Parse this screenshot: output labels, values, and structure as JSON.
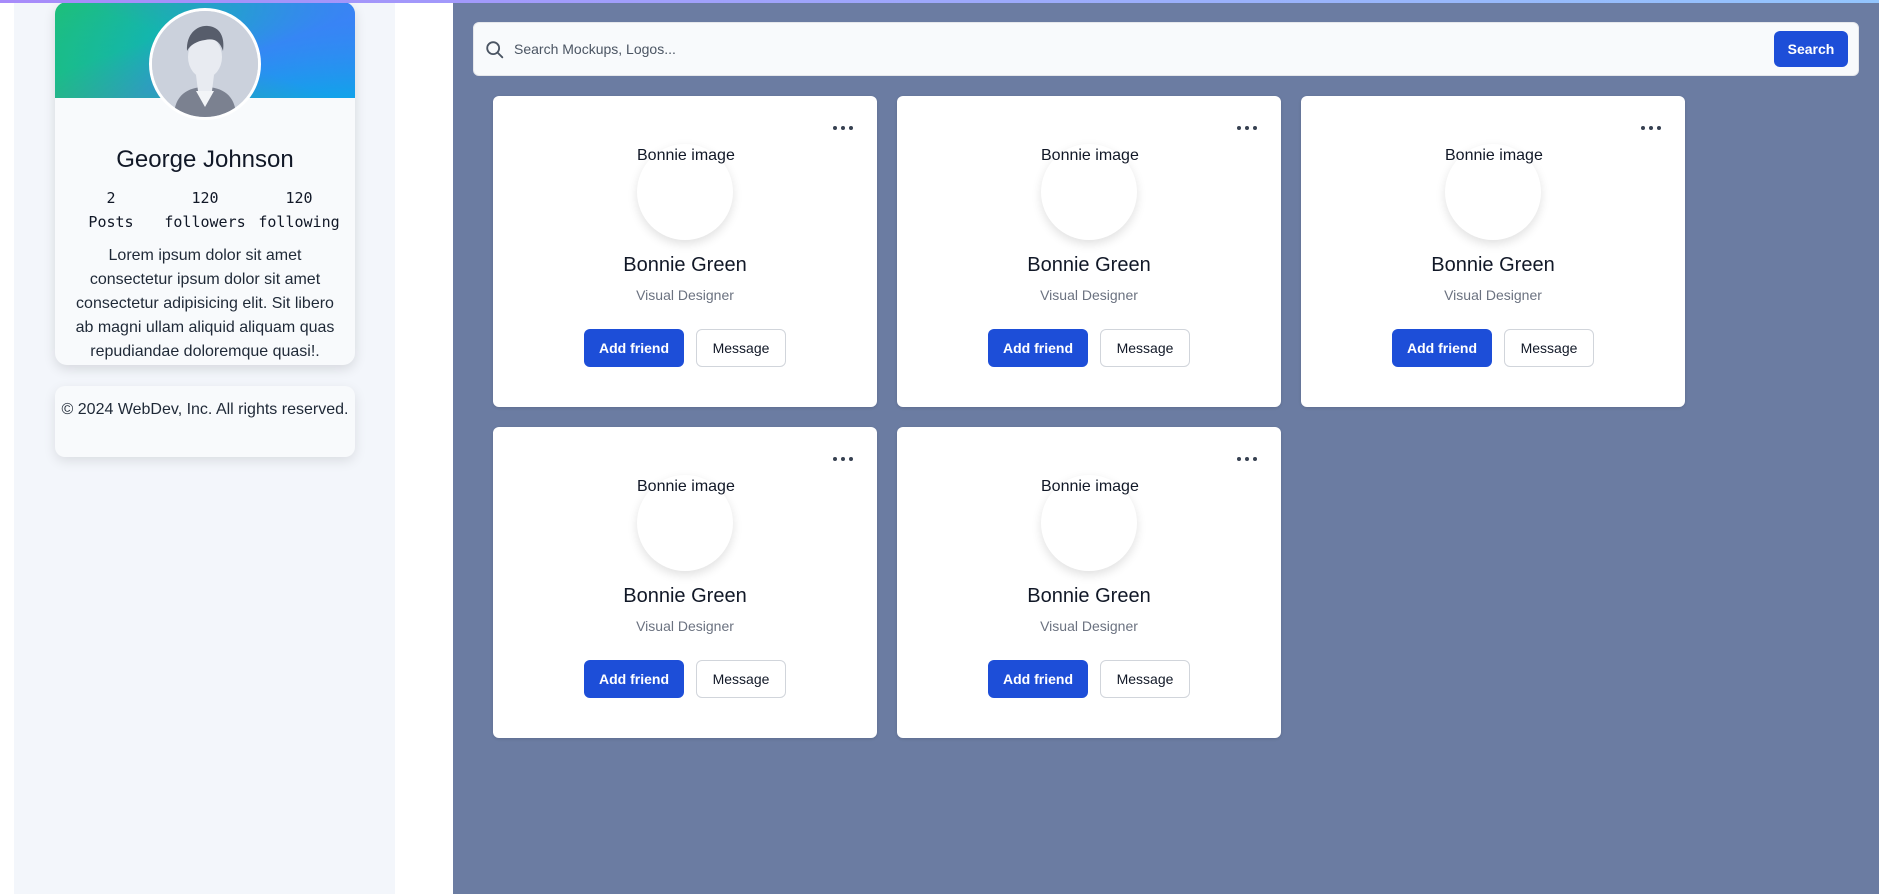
{
  "profile": {
    "name": "George Johnson",
    "stats": [
      {
        "value": "2",
        "label": "Posts"
      },
      {
        "value": "120",
        "label": "followers"
      },
      {
        "value": "120",
        "label": "following"
      }
    ],
    "bio": "Lorem ipsum dolor sit amet consectetur ipsum dolor sit amet consectetur adipisicing elit. Sit libero ab magni ullam aliquid aliquam quas repudiandae doloremque quasi!."
  },
  "footer": {
    "text": "© 2024 WebDev, Inc. All rights reserved."
  },
  "search": {
    "placeholder": "Search Mockups, Logos...",
    "button_label": "Search"
  },
  "cards": [
    {
      "img_alt": "Bonnie image",
      "name": "Bonnie Green",
      "role": "Visual Designer",
      "primary_label": "Add friend",
      "secondary_label": "Message"
    },
    {
      "img_alt": "Bonnie image",
      "name": "Bonnie Green",
      "role": "Visual Designer",
      "primary_label": "Add friend",
      "secondary_label": "Message"
    },
    {
      "img_alt": "Bonnie image",
      "name": "Bonnie Green",
      "role": "Visual Designer",
      "primary_label": "Add friend",
      "secondary_label": "Message"
    },
    {
      "img_alt": "Bonnie image",
      "name": "Bonnie Green",
      "role": "Visual Designer",
      "primary_label": "Add friend",
      "secondary_label": "Message"
    },
    {
      "img_alt": "Bonnie image",
      "name": "Bonnie Green",
      "role": "Visual Designer",
      "primary_label": "Add friend",
      "secondary_label": "Message"
    }
  ],
  "colors": {
    "accent": "#1d4ed8",
    "main_background": "#6b7ca2",
    "sidebar_background": "#f3f6fb"
  },
  "icons": {
    "search": "search-icon",
    "card_menu": "dots-horizontal-icon",
    "avatar": "user-silhouette-icon"
  }
}
